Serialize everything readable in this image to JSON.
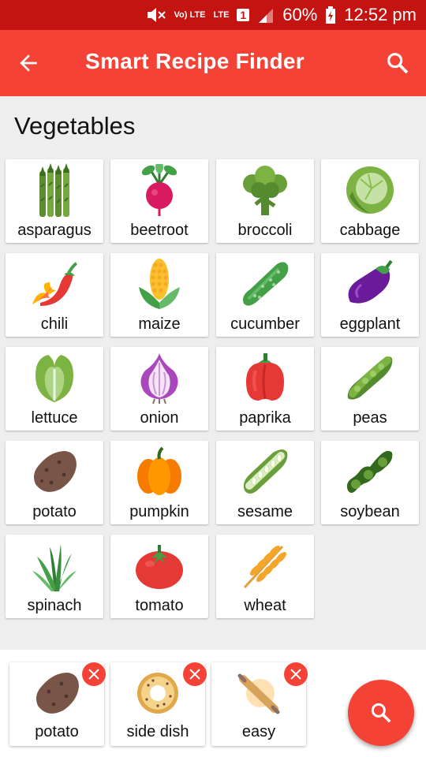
{
  "status_bar": {
    "network": "Vo) LTE",
    "lte": "LTE",
    "sim": "1",
    "battery": "60%",
    "time": "12:52 pm"
  },
  "app_bar": {
    "title": "Smart Recipe Finder",
    "back_icon": "arrow-back-icon",
    "search_icon": "search-icon",
    "color": "#f44336"
  },
  "section": {
    "title": "Vegetables"
  },
  "vegetables": [
    {
      "label": "asparagus",
      "icon": "asparagus"
    },
    {
      "label": "beetroot",
      "icon": "beetroot"
    },
    {
      "label": "broccoli",
      "icon": "broccoli"
    },
    {
      "label": "cabbage",
      "icon": "cabbage"
    },
    {
      "label": "chili",
      "icon": "chili"
    },
    {
      "label": "maize",
      "icon": "maize"
    },
    {
      "label": "cucumber",
      "icon": "cucumber"
    },
    {
      "label": "eggplant",
      "icon": "eggplant"
    },
    {
      "label": "lettuce",
      "icon": "lettuce"
    },
    {
      "label": "onion",
      "icon": "onion"
    },
    {
      "label": "paprika",
      "icon": "paprika"
    },
    {
      "label": "peas",
      "icon": "peas"
    },
    {
      "label": "potato",
      "icon": "potato"
    },
    {
      "label": "pumpkin",
      "icon": "pumpkin"
    },
    {
      "label": "sesame",
      "icon": "sesame"
    },
    {
      "label": "soybean",
      "icon": "soybean"
    },
    {
      "label": "spinach",
      "icon": "spinach"
    },
    {
      "label": "tomato",
      "icon": "tomato"
    },
    {
      "label": "wheat",
      "icon": "wheat"
    }
  ],
  "selected": [
    {
      "label": "potato",
      "icon": "potato"
    },
    {
      "label": "side dish",
      "icon": "donut"
    },
    {
      "label": "easy",
      "icon": "rolling-pin"
    }
  ],
  "fab": {
    "icon": "search-icon",
    "color": "#f44336"
  }
}
